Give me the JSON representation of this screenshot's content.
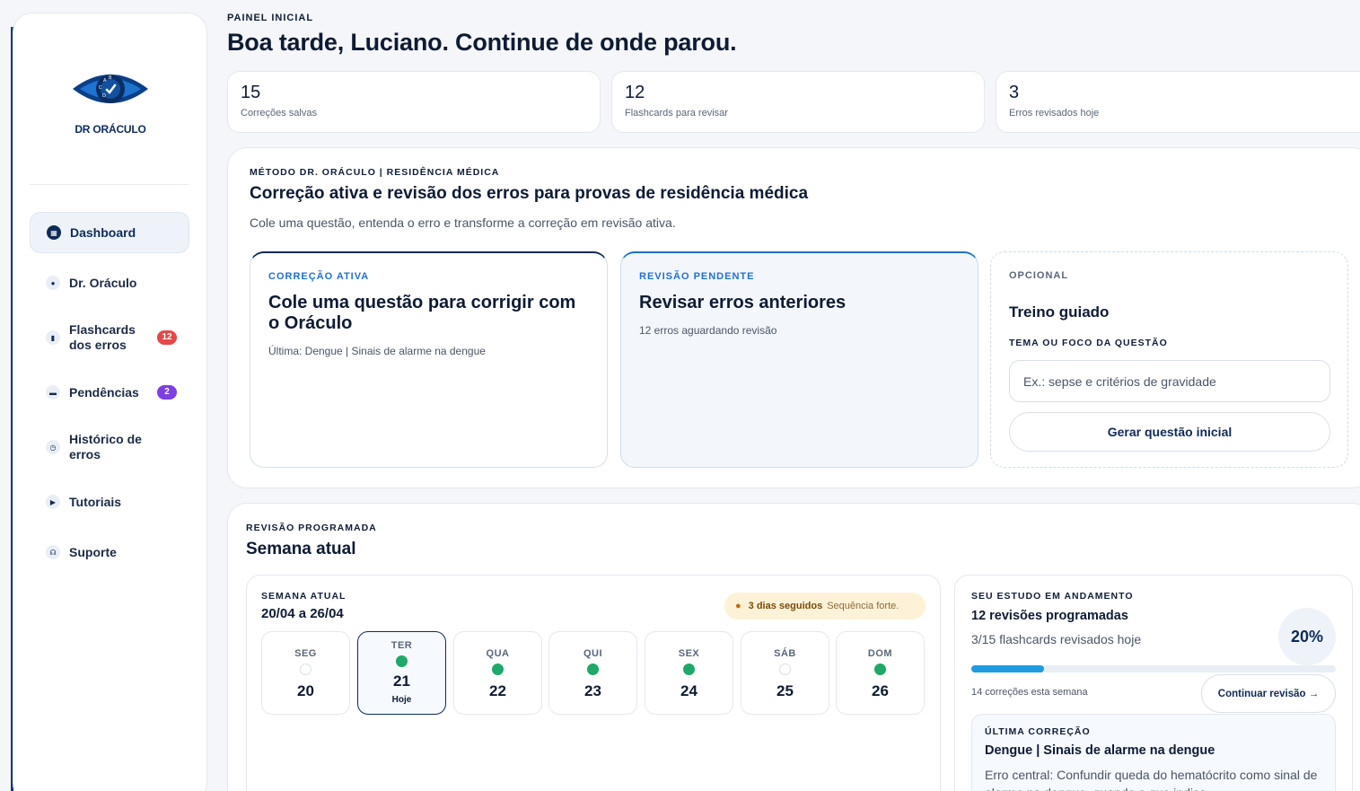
{
  "app": {
    "logo_text": "DR ORÁCULO"
  },
  "sidebar": {
    "items": [
      {
        "label": "Dashboard",
        "icon": "grid-icon",
        "active": true
      },
      {
        "label": "Dr. Oráculo",
        "icon": "chat-icon"
      },
      {
        "label": "Flashcards dos erros",
        "icon": "book-icon",
        "badge": "12"
      },
      {
        "label": "Pendências",
        "icon": "message-icon",
        "badge": "2"
      },
      {
        "label": "Histórico de erros",
        "icon": "history-icon"
      },
      {
        "label": "Tutoriais",
        "icon": "play-icon"
      },
      {
        "label": "Suporte",
        "icon": "headset-icon"
      }
    ]
  },
  "header": {
    "eyebrow": "PAINEL INICIAL",
    "title": "Boa tarde, Luciano. Continue de onde parou."
  },
  "stats": [
    {
      "value": "15",
      "label": "Correções salvas"
    },
    {
      "value": "12",
      "label": "Flashcards para revisar"
    },
    {
      "value": "3",
      "label": "Erros revisados hoje"
    }
  ],
  "method": {
    "eyebrow": "MÉTODO DR. ORÁCULO | RESIDÊNCIA MÉDICA",
    "title": "Correção ativa e revisão dos erros para provas de residência médica",
    "subtitle": "Cole uma questão, entenda o erro e transforme a correção em revisão ativa.",
    "cards": {
      "active": {
        "eyebrow": "CORREÇÃO ATIVA",
        "title": "Cole uma questão para corrigir com o Oráculo",
        "sub": "Última: Dengue | Sinais de alarme na dengue"
      },
      "pending": {
        "eyebrow": "REVISÃO PENDENTE",
        "title": "Revisar erros anteriores",
        "sub": "12 erros aguardando revisão"
      },
      "optional": {
        "eyebrow": "OPCIONAL",
        "title": "Treino guiado",
        "field_label": "TEMA OU FOCO DA QUESTÃO",
        "placeholder": "Ex.: sepse e critérios de gravidade",
        "button": "Gerar questão inicial"
      }
    }
  },
  "review": {
    "eyebrow": "REVISÃO PROGRAMADA",
    "title": "Semana atual",
    "week": {
      "eyebrow": "SEMANA ATUAL",
      "range": "20/04 a 26/04",
      "streak": "3 dias seguidos",
      "streak_note": "Sequência forte.",
      "days": [
        {
          "name": "SEG",
          "num": "20",
          "done": false
        },
        {
          "name": "TER",
          "num": "21",
          "done": true,
          "today": true,
          "today_label": "Hoje"
        },
        {
          "name": "QUA",
          "num": "22",
          "done": true
        },
        {
          "name": "QUI",
          "num": "23",
          "done": true
        },
        {
          "name": "SEX",
          "num": "24",
          "done": true
        },
        {
          "name": "SÁB",
          "num": "25",
          "done": false
        },
        {
          "name": "DOM",
          "num": "26",
          "done": true
        }
      ]
    },
    "progress": {
      "eyebrow": "SEU ESTUDO EM ANDAMENTO",
      "title": "12 revisões programadas",
      "sub": "3/15 flashcards revisados hoje",
      "percent_label": "20%",
      "percent": 20,
      "corrections": "14 correções esta semana",
      "button": "Continuar revisão →"
    },
    "last": {
      "eyebrow": "ÚLTIMA CORREÇÃO",
      "title": "Dengue | Sinais de alarme na dengue",
      "text": "Erro central: Confundir queda do hematócrito como sinal de alarme na dengue, quando o que indica"
    }
  },
  "colors": {
    "accent": "#1f6fd1",
    "navy": "#0f2a55",
    "success": "#1fa868",
    "badge_red": "#e54848",
    "badge_purple": "#7b3fe4"
  }
}
